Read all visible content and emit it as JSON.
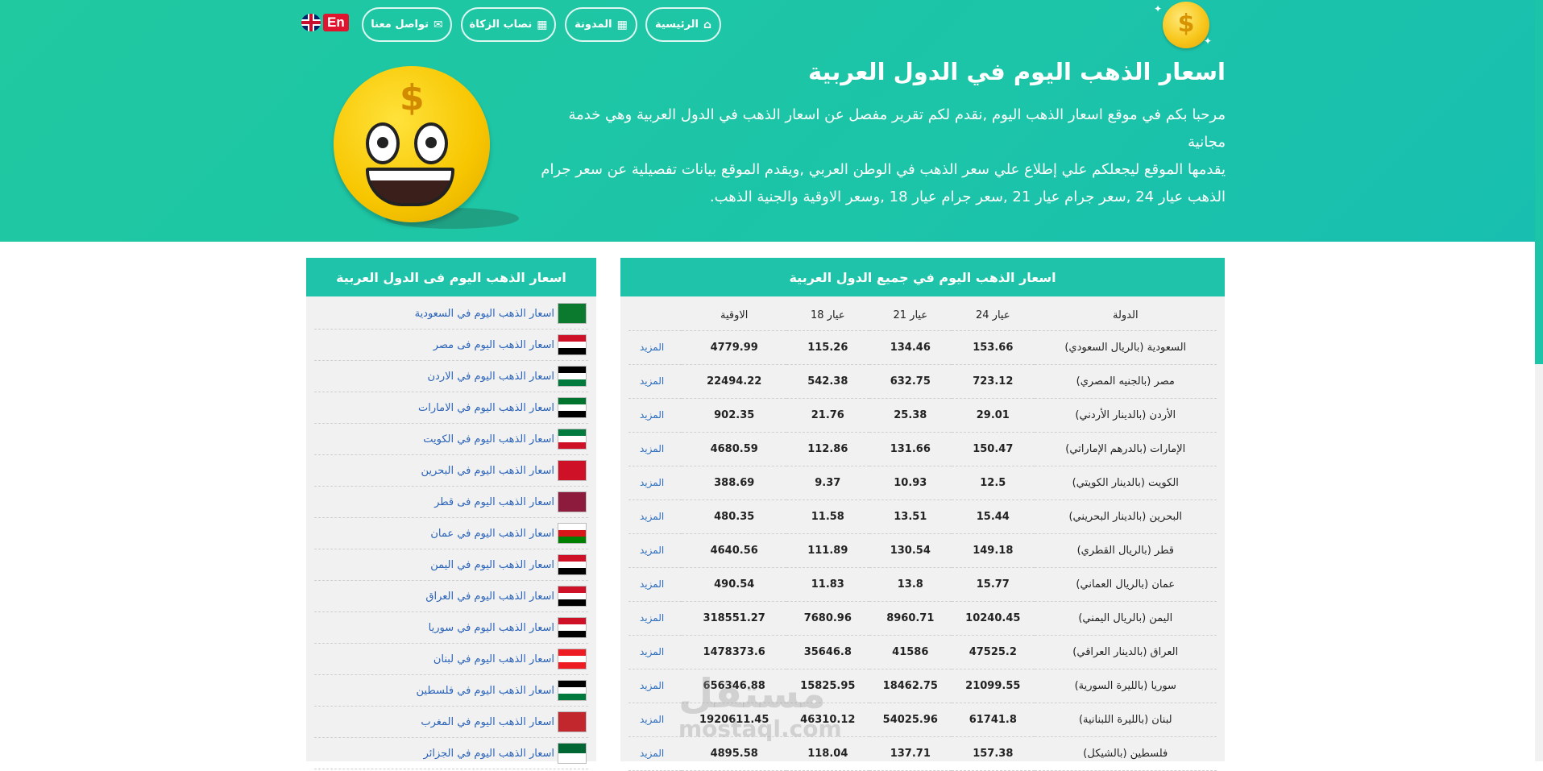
{
  "nav": {
    "home": "الرئيسية",
    "blog": "المدونة",
    "zakat": "نصاب الزكاة",
    "contact": "تواصل معنا",
    "lang": "En"
  },
  "logo": {
    "symbol": "$"
  },
  "hero": {
    "title": "اسعار الذهب اليوم في الدول العربية",
    "line1": "مرحبا بكم في موقع اسعار الذهب اليوم ,نقدم لكم تقرير مفصل عن اسعار الذهب في الدول العربية وهي خدمة مجانية",
    "line2": "يقدمها الموقع ليجعلكم علي إطلاع علي سعر الذهب في الوطن العربي ,ويقدم الموقع بيانات تفصيلية عن سعر جرام",
    "line3": "الذهب عيار 24 ,سعر جرام عيار 21 ,سعر جرام عيار 18 ,وسعر الاوقية والجنية الذهب."
  },
  "main_table": {
    "heading": "اسعار الذهب اليوم في جميع الدول العربية",
    "columns": [
      "الدولة",
      "عيار 24",
      "عيار 21",
      "عيار 18",
      "الاوقية",
      ""
    ],
    "more_label": "المزيد",
    "rows": [
      [
        "السعودية (بالريال السعودي)",
        "153.66",
        "134.46",
        "115.26",
        "4779.99"
      ],
      [
        "مصر (بالجنيه المصري)",
        "723.12",
        "632.75",
        "542.38",
        "22494.22"
      ],
      [
        "الأردن (بالدينار الأردني)",
        "29.01",
        "25.38",
        "21.76",
        "902.35"
      ],
      [
        "الإمارات (بالدرهم الإماراتي)",
        "150.47",
        "131.66",
        "112.86",
        "4680.59"
      ],
      [
        "الكويت (بالدينار الكويتي)",
        "12.5",
        "10.93",
        "9.37",
        "388.69"
      ],
      [
        "البحرين (بالدينار البحريني)",
        "15.44",
        "13.51",
        "11.58",
        "480.35"
      ],
      [
        "قطر (بالريال القطري)",
        "149.18",
        "130.54",
        "111.89",
        "4640.56"
      ],
      [
        "عمان (بالريال العماني)",
        "15.77",
        "13.8",
        "11.83",
        "490.54"
      ],
      [
        "اليمن (بالريال اليمني)",
        "10240.45",
        "8960.71",
        "7680.96",
        "318551.27"
      ],
      [
        "العراق (بالدينار العراقي)",
        "47525.2",
        "41586",
        "35646.8",
        "1478373.6"
      ],
      [
        "سوريا (بالليرة السورية)",
        "21099.55",
        "18462.75",
        "15825.95",
        "656346.88"
      ],
      [
        "لبنان (بالليرة اللبنانية)",
        "61741.8",
        "54025.96",
        "46310.12",
        "1920611.45"
      ],
      [
        "فلسطين (بالشيكل)",
        "157.38",
        "137.71",
        "118.04",
        "4895.58"
      ]
    ]
  },
  "side_list": {
    "heading": "اسعار الذهب اليوم فى الدول العربية",
    "items": [
      {
        "label": "اسعار الذهب اليوم في السعودية",
        "flag": "saudi-flag-icon",
        "colors": [
          "#0b7a2f"
        ]
      },
      {
        "label": "اسعار الذهب اليوم فى مصر",
        "flag": "egypt-flag-icon",
        "colors": [
          "#ce1126",
          "#ffffff",
          "#000000"
        ]
      },
      {
        "label": "اسعار الذهب اليوم في الاردن",
        "flag": "jordan-flag-icon",
        "colors": [
          "#000000",
          "#ffffff",
          "#007a3d"
        ]
      },
      {
        "label": "اسعار الذهب اليوم في الامارات",
        "flag": "uae-flag-icon",
        "colors": [
          "#00732f",
          "#ffffff",
          "#000000"
        ]
      },
      {
        "label": "اسعار الذهب اليوم في الكويت",
        "flag": "kuwait-flag-icon",
        "colors": [
          "#007a3d",
          "#ffffff",
          "#ce1126"
        ]
      },
      {
        "label": "اسعار الذهب اليوم في البحرين",
        "flag": "bahrain-flag-icon",
        "colors": [
          "#ce1126"
        ]
      },
      {
        "label": "اسعار الذهب اليوم فى قطر",
        "flag": "qatar-flag-icon",
        "colors": [
          "#8d1b3d"
        ]
      },
      {
        "label": "اسعار الذهب اليوم في عمان",
        "flag": "oman-flag-icon",
        "colors": [
          "#ffffff",
          "#db161b",
          "#008000"
        ]
      },
      {
        "label": "اسعار الذهب اليوم في اليمن",
        "flag": "yemen-flag-icon",
        "colors": [
          "#ce1126",
          "#ffffff",
          "#000000"
        ]
      },
      {
        "label": "اسعار الذهب اليوم في العراق",
        "flag": "iraq-flag-icon",
        "colors": [
          "#ce1126",
          "#ffffff",
          "#000000"
        ]
      },
      {
        "label": "اسعار الذهب اليوم في سوريا",
        "flag": "syria-flag-icon",
        "colors": [
          "#ce1126",
          "#ffffff",
          "#000000"
        ]
      },
      {
        "label": "اسعار الذهب اليوم في لبنان",
        "flag": "lebanon-flag-icon",
        "colors": [
          "#ed1c24",
          "#ffffff",
          "#ed1c24"
        ]
      },
      {
        "label": "اسعار الذهب اليوم في فلسطين",
        "flag": "palestine-flag-icon",
        "colors": [
          "#000000",
          "#ffffff",
          "#007a3d"
        ]
      },
      {
        "label": "اسعار الذهب اليوم في المغرب",
        "flag": "morocco-flag-icon",
        "colors": [
          "#c1272d"
        ]
      },
      {
        "label": "اسعار الذهب اليوم في الجزائر",
        "flag": "algeria-flag-icon",
        "colors": [
          "#006633",
          "#ffffff"
        ]
      }
    ]
  },
  "watermark": {
    "line1": "مستقل",
    "line2": "mostaql.com"
  },
  "colors": {
    "brand": "#1fc3a9",
    "link": "#2a63b8",
    "gold": "#f7c600"
  }
}
